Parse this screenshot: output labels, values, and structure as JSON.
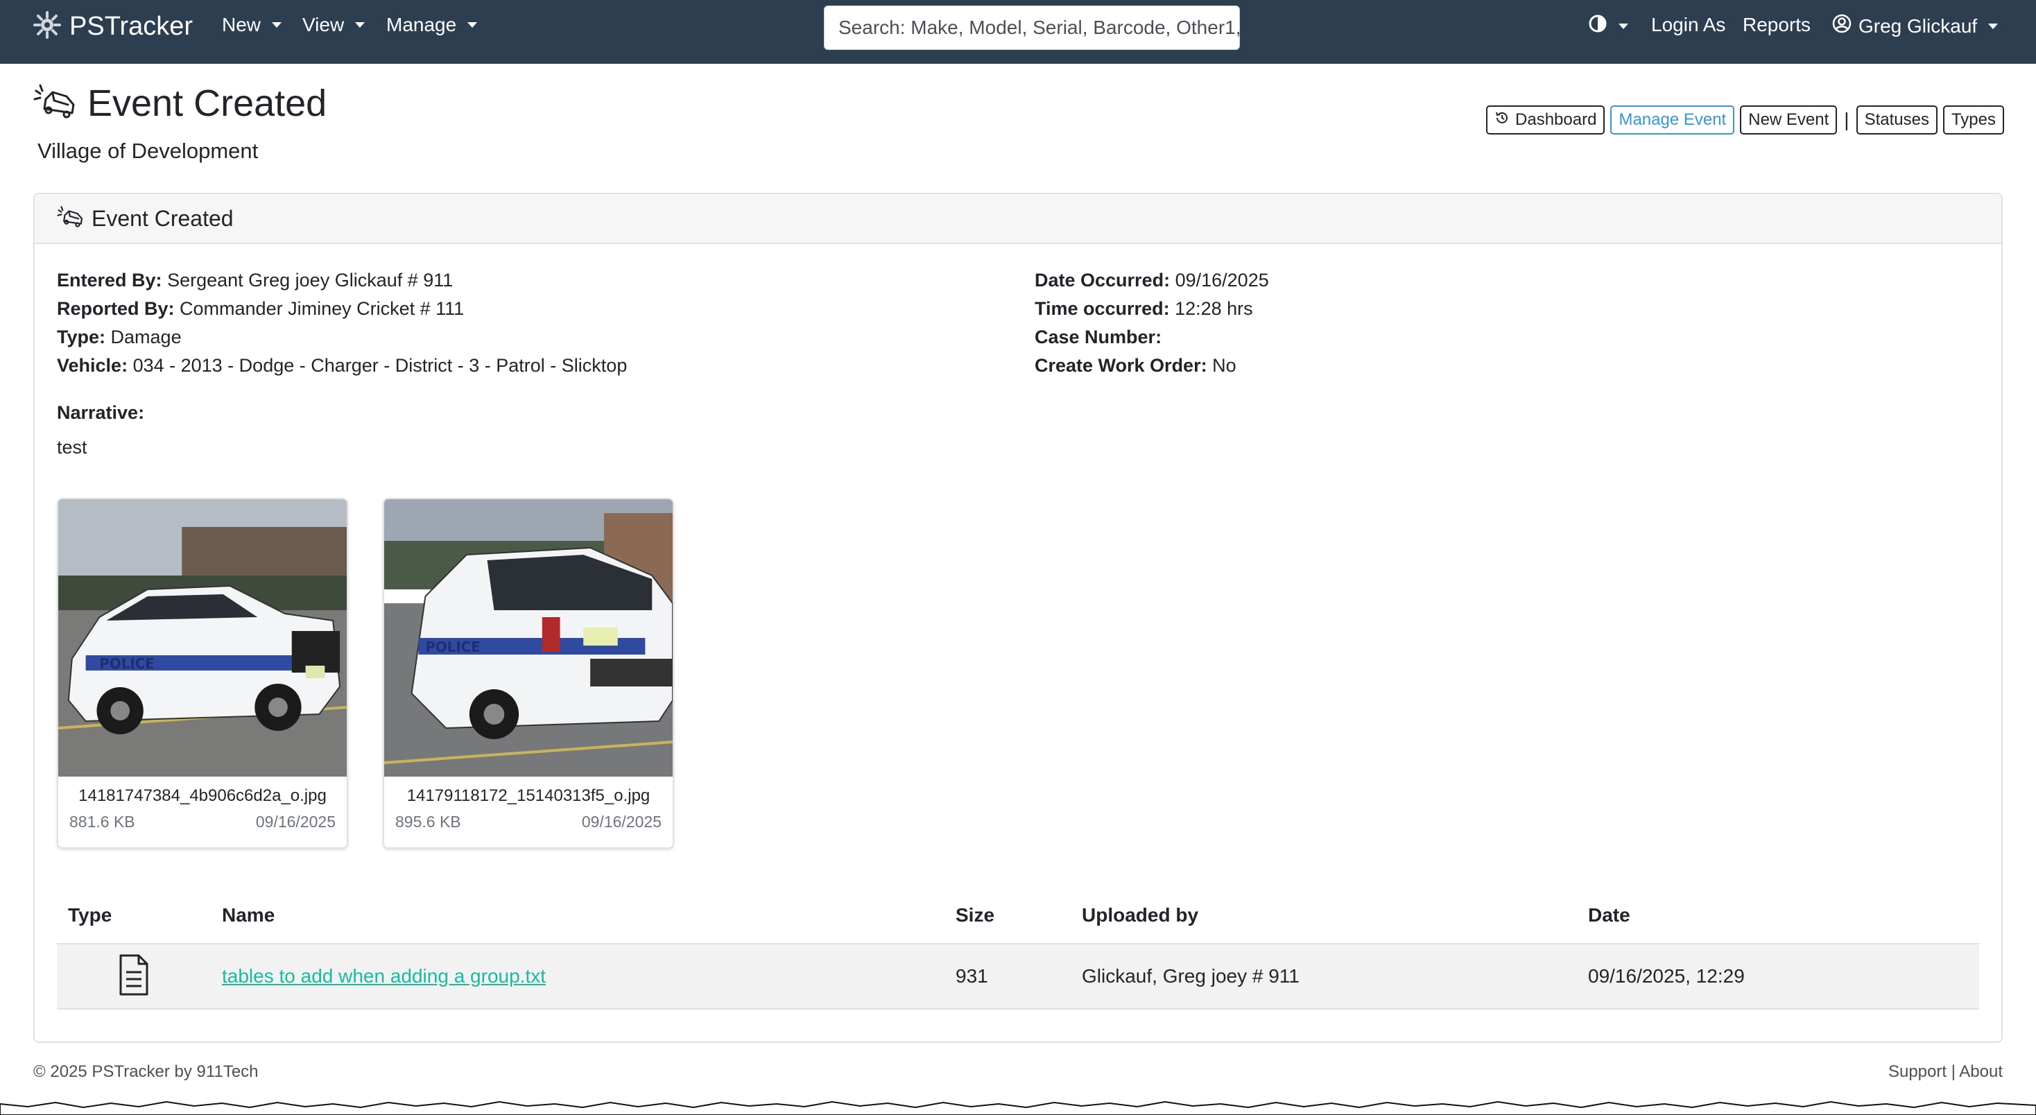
{
  "navbar": {
    "brand": "PSTracker",
    "menus": [
      {
        "label": "New"
      },
      {
        "label": "View"
      },
      {
        "label": "Manage"
      }
    ],
    "search_placeholder": "Search: Make, Model, Serial, Barcode, Other1, ...",
    "login_as": "Login As",
    "reports": "Reports",
    "user": "Greg Glickauf"
  },
  "page": {
    "title": "Event Created",
    "subtitle": "Village of Development"
  },
  "actions": {
    "dashboard": "Dashboard",
    "manage_event": "Manage Event",
    "new_event": "New Event",
    "separator": "|",
    "statuses": "Statuses",
    "types": "Types"
  },
  "card": {
    "header": "Event Created",
    "left": [
      {
        "label": "Entered By:",
        "value": "Sergeant Greg joey Glickauf # 911"
      },
      {
        "label": "Reported By:",
        "value": "Commander Jiminey Cricket # 111"
      },
      {
        "label": "Type:",
        "value": "Damage"
      },
      {
        "label": "Vehicle:",
        "value": "034 - 2013 - Dodge - Charger - District - 3 - Patrol - Slicktop"
      }
    ],
    "right": [
      {
        "label": "Date Occurred:",
        "value": "09/16/2025"
      },
      {
        "label": "Time occurred:",
        "value": "12:28 hrs"
      },
      {
        "label": "Case Number:",
        "value": ""
      },
      {
        "label": "Create Work Order:",
        "value": "No"
      }
    ],
    "narrative_label": "Narrative:",
    "narrative": "test",
    "photos": [
      {
        "filename": "14181747384_4b906c6d2a_o.jpg",
        "size": "881.6 KB",
        "date": "09/16/2025"
      },
      {
        "filename": "14179118172_15140313f5_o.jpg",
        "size": "895.6 KB",
        "date": "09/16/2025"
      }
    ],
    "files_table": {
      "headers": [
        "Type",
        "Name",
        "Size",
        "Uploaded by",
        "Date"
      ],
      "rows": [
        {
          "type_icon": "file-text-icon",
          "name": "tables to add when adding a group.txt",
          "size": "931",
          "uploaded_by": "Glickauf, Greg joey # 911",
          "date": "09/16/2025, 12:29"
        }
      ]
    }
  },
  "footer": {
    "copyright": "© 2025  PSTracker by 911Tech",
    "support": "Support",
    "divider": "|",
    "about": "About"
  },
  "colors": {
    "navbar": "#2c3e50",
    "primary": "#3498db",
    "link": "#18bc9c"
  }
}
